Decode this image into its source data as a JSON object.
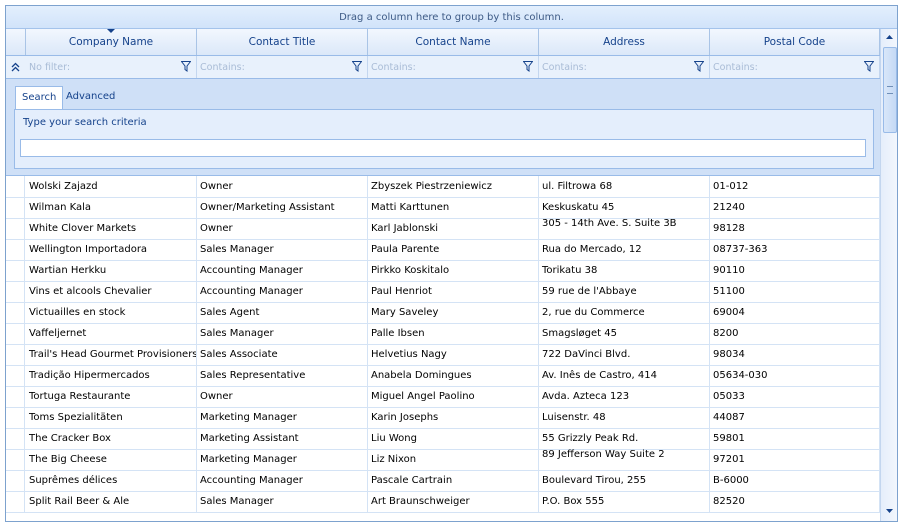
{
  "group_panel": {
    "text": "Drag a column here to group by this column."
  },
  "columns": [
    {
      "title": "Company Name",
      "filter_placeholder": "No filter:"
    },
    {
      "title": "Contact Title",
      "filter_placeholder": "Contains:"
    },
    {
      "title": "Contact Name",
      "filter_placeholder": "Contains:"
    },
    {
      "title": "Address",
      "filter_placeholder": "Contains:"
    },
    {
      "title": "Postal Code",
      "filter_placeholder": "Contains:"
    }
  ],
  "search": {
    "tabs": [
      "Search",
      "Advanced"
    ],
    "active_tab": "Search",
    "prompt": "Type your search criteria",
    "value": ""
  },
  "rows": [
    [
      "Wolski  Zajazd",
      "Owner",
      "Zbyszek Piestrzeniewicz",
      "ul. Filtrowa 68",
      "01-012"
    ],
    [
      "Wilman Kala",
      "Owner/Marketing Assistant",
      "Matti Karttunen",
      "Keskuskatu 45",
      "21240"
    ],
    [
      "White Clover Markets",
      "Owner",
      "Karl Jablonski",
      "305 - 14th Ave. S. Suite 3B",
      "98128"
    ],
    [
      "Wellington Importadora",
      "Sales Manager",
      "Paula Parente",
      "Rua do Mercado, 12",
      "08737-363"
    ],
    [
      "Wartian Herkku",
      "Accounting Manager",
      "Pirkko Koskitalo",
      "Torikatu 38",
      "90110"
    ],
    [
      "Vins et alcools Chevalier",
      "Accounting Manager",
      "Paul Henriot",
      "59 rue de l'Abbaye",
      "51100"
    ],
    [
      "Victuailles en stock",
      "Sales Agent",
      "Mary Saveley",
      "2, rue du Commerce",
      "69004"
    ],
    [
      "Vaffeljernet",
      "Sales Manager",
      "Palle Ibsen",
      "Smagsløget 45",
      "8200"
    ],
    [
      "Trail's Head Gourmet Provisioners",
      "Sales Associate",
      "Helvetius Nagy",
      "722 DaVinci Blvd.",
      "98034"
    ],
    [
      "Tradição Hipermercados",
      "Sales Representative",
      "Anabela Domingues",
      "Av. Inês de Castro, 414",
      "05634-030"
    ],
    [
      "Tortuga Restaurante",
      "Owner",
      "Miguel Angel Paolino",
      "Avda. Azteca 123",
      "05033"
    ],
    [
      "Toms Spezialitäten",
      "Marketing Manager",
      "Karin Josephs",
      "Luisenstr. 48",
      "44087"
    ],
    [
      "The Cracker Box",
      "Marketing Assistant",
      "Liu Wong",
      "55 Grizzly Peak Rd.",
      "59801"
    ],
    [
      "The Big Cheese",
      "Marketing Manager",
      "Liz Nixon",
      "89 Jefferson Way Suite 2",
      "97201"
    ],
    [
      "Suprêmes délices",
      "Accounting Manager",
      "Pascale Cartrain",
      "Boulevard Tirou, 255",
      "B-6000"
    ],
    [
      "Split Rail Beer & Ale",
      "Sales Manager",
      "Art Braunschweiger",
      "P.O. Box 555",
      "82520"
    ]
  ],
  "scrollbar": {
    "up_icon": "scroll-up-arrow",
    "down_icon": "scroll-down-arrow"
  }
}
